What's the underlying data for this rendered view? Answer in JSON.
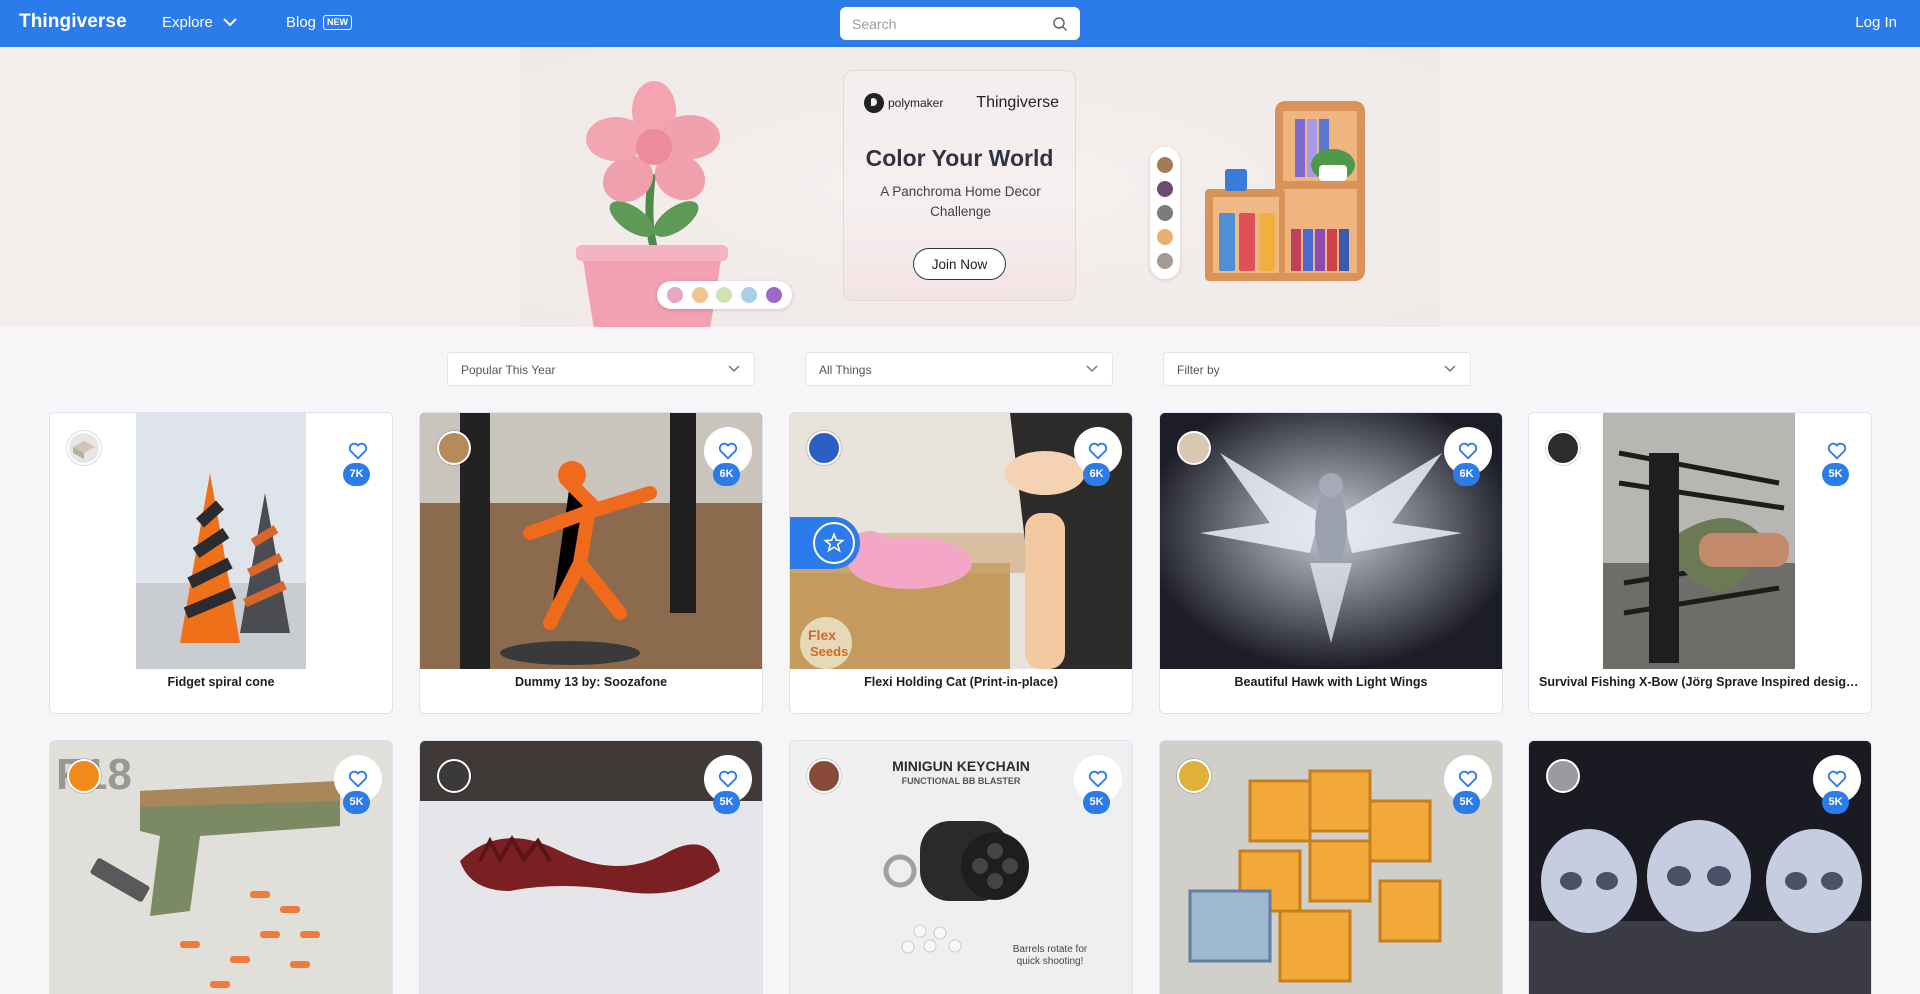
{
  "header": {
    "logo": "Thingiverse",
    "explore_label": "Explore",
    "blog_label": "Blog",
    "blog_badge": "NEW",
    "search_placeholder": "Search",
    "login_label": "Log In",
    "bar_color": "#2b7bea"
  },
  "banner": {
    "sponsor": "polymaker",
    "brand": "Thingiverse",
    "title": "Color Your World",
    "subtitle": "A Panchroma Home Decor Challenge",
    "cta_label": "Join Now",
    "flower_swatches": [
      "#e8a6c2",
      "#f1c48e",
      "#cfe2b3",
      "#a9cfe8",
      "#9a6ac8"
    ],
    "shelf_swatches": [
      "#a47b55",
      "#6f4a6f",
      "#7c7c80",
      "#e9b06e",
      "#a39a93"
    ]
  },
  "filters": {
    "sort": "Popular This Year",
    "type": "All Things",
    "filter": "Filter by"
  },
  "cards": [
    {
      "title": "Fidget spiral cone",
      "likes": "7K",
      "icon": "heart-icon"
    },
    {
      "title": "Dummy 13 by: Soozafone",
      "likes": "6K",
      "icon": "heart-icon"
    },
    {
      "title": "Flexi Holding Cat (Print-in-place)",
      "likes": "6K",
      "icon": "heart-icon",
      "featured": true,
      "image_text": [
        "Flex",
        "Seeds"
      ]
    },
    {
      "title": "Beautiful Hawk with Light Wings",
      "likes": "6K",
      "icon": "heart-icon"
    },
    {
      "title": "Survival Fishing X-Bow (Jörg Sprave Inspired design) V...",
      "likes": "5K",
      "icon": "heart-icon"
    },
    {
      "title": "",
      "likes": "5K",
      "icon": "heart-icon",
      "image_text": [
        "F18"
      ]
    },
    {
      "title": "",
      "likes": "5K",
      "icon": "heart-icon"
    },
    {
      "title": "",
      "likes": "5K",
      "icon": "heart-icon",
      "image_text": [
        "MINIGUN KEYCHAIN",
        "FUNCTIONAL BB BLASTER",
        "Barrels rotate for",
        "quick shooting!"
      ]
    },
    {
      "title": "",
      "likes": "5K",
      "icon": "heart-icon"
    },
    {
      "title": "",
      "likes": "5K",
      "icon": "heart-icon"
    }
  ]
}
